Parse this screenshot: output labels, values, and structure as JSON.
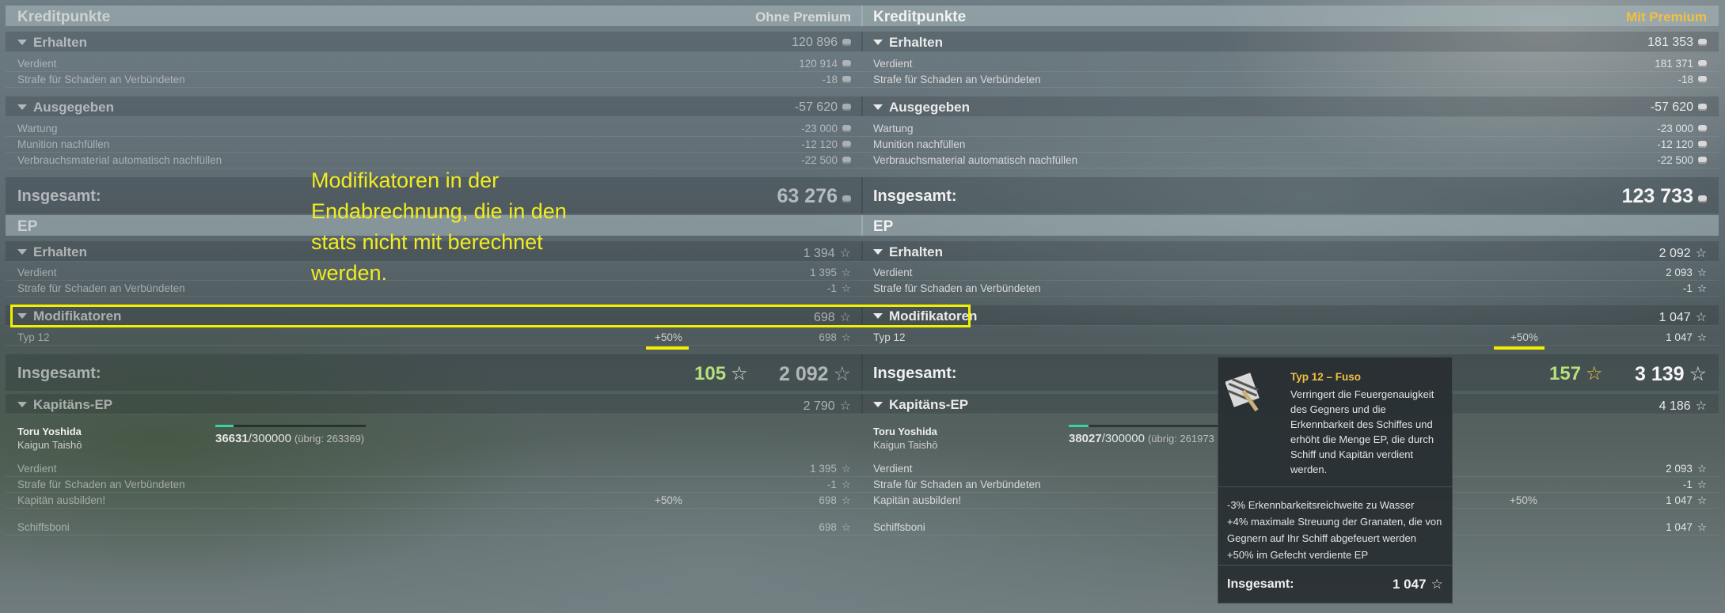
{
  "left": {
    "credits_header": "Kreditpunkte",
    "mode": "Ohne Premium",
    "earned": {
      "label": "Erhalten",
      "value": "120 896",
      "items": [
        {
          "label": "Verdient",
          "value": "120 914"
        },
        {
          "label": "Strafe für Schaden an Verbündeten",
          "value": "-18"
        }
      ]
    },
    "spent": {
      "label": "Ausgegeben",
      "value": "-57 620",
      "items": [
        {
          "label": "Wartung",
          "value": "-23 000"
        },
        {
          "label": "Munition nachfüllen",
          "value": "-12 120"
        },
        {
          "label": "Verbrauchsmaterial automatisch nachfüllen",
          "value": "-22 500"
        }
      ]
    },
    "credits_total": {
      "label": "Insgesamt:",
      "value": "63 276"
    },
    "ep_header": "EP",
    "ep_earned": {
      "label": "Erhalten",
      "value": "1 394",
      "items": [
        {
          "label": "Verdient",
          "value": "1 395"
        },
        {
          "label": "Strafe für Schaden an Verbündeten",
          "value": "-1"
        }
      ]
    },
    "modifiers": {
      "label": "Modifikatoren",
      "value": "698",
      "item": {
        "label": "Typ 12",
        "mod": "+50%",
        "value": "698"
      }
    },
    "ep_total": {
      "label": "Insgesamt:",
      "green": "105",
      "value": "2 092"
    },
    "captain": {
      "label": "Kapitäns-EP",
      "value": "2 790",
      "name": "Toru Yoshida",
      "rank": "Kaigun Taishō",
      "xp": "36631",
      "xp_max": "/300000",
      "remaining": "(übrig: 263369)",
      "progress": 0.12,
      "items": [
        {
          "label": "Verdient",
          "value": "1 395",
          "mod": ""
        },
        {
          "label": "Strafe für Schaden an Verbündeten",
          "value": "-1",
          "mod": ""
        },
        {
          "label": "Kapitän ausbilden!",
          "value": "698",
          "mod": "+50%"
        }
      ],
      "bonus": {
        "label": "Schiffsboni",
        "value": "698"
      }
    }
  },
  "right": {
    "credits_header": "Kreditpunkte",
    "mode": "Mit Premium",
    "earned": {
      "label": "Erhalten",
      "value": "181 353",
      "items": [
        {
          "label": "Verdient",
          "value": "181 371"
        },
        {
          "label": "Strafe für Schaden an Verbündeten",
          "value": "-18"
        }
      ]
    },
    "spent": {
      "label": "Ausgegeben",
      "value": "-57 620",
      "items": [
        {
          "label": "Wartung",
          "value": "-23 000"
        },
        {
          "label": "Munition nachfüllen",
          "value": "-12 120"
        },
        {
          "label": "Verbrauchsmaterial automatisch nachfüllen",
          "value": "-22 500"
        }
      ]
    },
    "credits_total": {
      "label": "Insgesamt:",
      "value": "123 733"
    },
    "ep_header": "EP",
    "ep_earned": {
      "label": "Erhalten",
      "value": "2 092",
      "items": [
        {
          "label": "Verdient",
          "value": "2 093"
        },
        {
          "label": "Strafe für Schaden an Verbündeten",
          "value": "-1"
        }
      ]
    },
    "modifiers": {
      "label": "Modifikatoren",
      "value": "1 047",
      "item": {
        "label": "Typ 12",
        "mod": "+50%",
        "value": "1 047"
      }
    },
    "ep_total": {
      "label": "Insgesamt:",
      "green": "157",
      "value": "3 139"
    },
    "captain": {
      "label": "Kapitäns-EP",
      "value": "4 186",
      "name": "Toru Yoshida",
      "rank": "Kaigun Taishō",
      "xp": "38027",
      "xp_max": "/300000",
      "remaining": "(übrig: 261973",
      "progress": 0.13,
      "items": [
        {
          "label": "Verdient",
          "value": "2 093",
          "mod": ""
        },
        {
          "label": "Strafe für Schaden an Verbündeten",
          "value": "-1",
          "mod": ""
        },
        {
          "label": "Kapitän ausbilden!",
          "value": "1 047",
          "mod": "+50%"
        }
      ],
      "bonus": {
        "label": "Schiffsboni",
        "value": "1 047"
      }
    }
  },
  "annotation": "Modifikatoren in der Endabrechnung, die in den stats nicht mit berechnet werden.",
  "tooltip": {
    "title": "Typ 12 – Fuso",
    "description": "Verringert die Feuergenauigkeit des Gegners und die Erkennbarkeit des Schiffes und erhöht die Menge EP, die durch Schiff und Kapitän verdient werden.",
    "effects": [
      "-3% Erkennbarkeitsreichweite zu Wasser",
      "+4% maximale Streuung der Granaten, die von Gegnern auf Ihr Schiff abgefeuert werden",
      "+50% im Gefecht verdiente EP"
    ],
    "total_label": "Insgesamt:",
    "total_value": "1 047"
  },
  "colors": {
    "highlight": "#f2f000",
    "premium": "#f0c040",
    "green": "#b6e07a",
    "progress": "#37d3a6"
  },
  "icons": {
    "credits": "coin-icon",
    "xp": "star-icon",
    "collapse": "triangle-down-icon"
  }
}
